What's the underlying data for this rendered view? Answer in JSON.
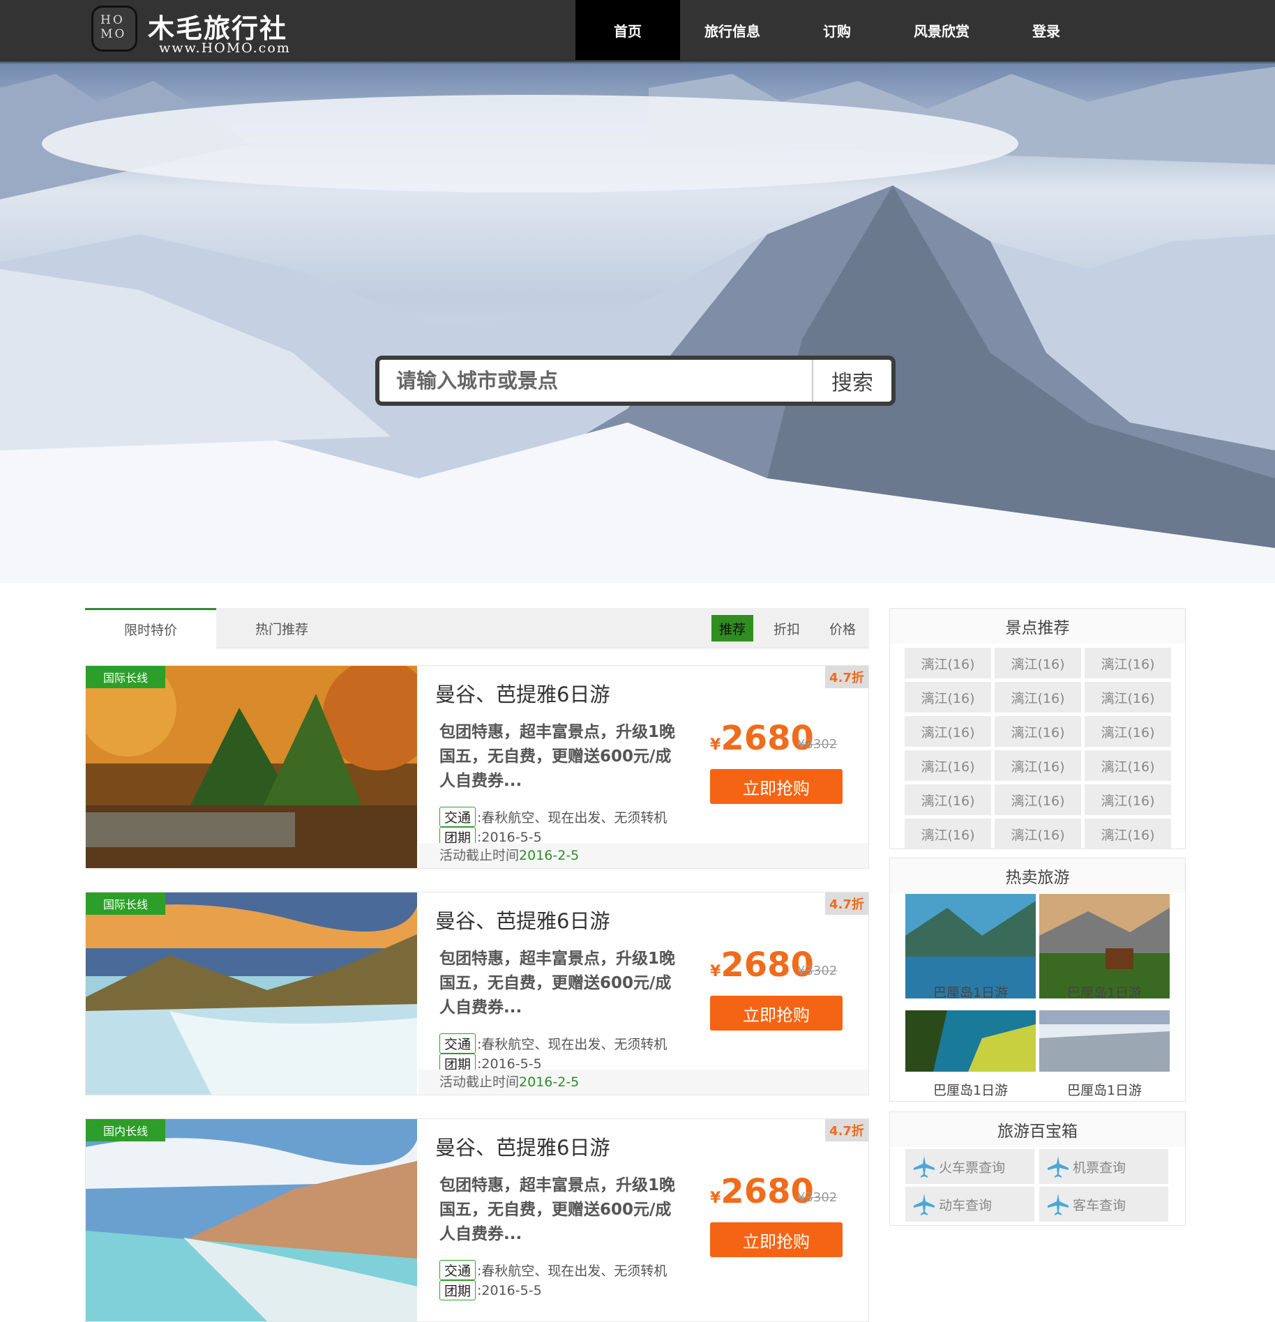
{
  "brand": {
    "badge": "HO\nMO",
    "name": "木毛旅行社",
    "url": "www.HOMO.com"
  },
  "nav": [
    "首页",
    "旅行信息",
    "订购",
    "风景欣赏",
    "登录"
  ],
  "search": {
    "placeholder": "请输入城市或景点",
    "button": "搜索"
  },
  "tabs": [
    "限时特价",
    "热门推荐"
  ],
  "sort": [
    "推荐",
    "折扣",
    "价格"
  ],
  "products": [
    {
      "tag": "国际长线",
      "discount": "4.7折",
      "title": "曼谷、芭提雅6日游",
      "desc": "包团特惠，超丰富景点，升级1晚国五，无自费，更赠送600元/成人自费券...",
      "traffic_label": "交通",
      "traffic": ":春秋航空、现在出发、无须转机",
      "group_label": "团期",
      "group": ":2016-5-5",
      "deadline_label": "活动截止时间",
      "deadline": "2016-2-5",
      "yen": "¥",
      "price": "2680",
      "old_price": "¥3302",
      "buy": "立即抢购"
    },
    {
      "tag": "国际长线",
      "discount": "4.7折",
      "title": "曼谷、芭提雅6日游",
      "desc": "包团特惠，超丰富景点，升级1晚国五，无自费，更赠送600元/成人自费券...",
      "traffic_label": "交通",
      "traffic": ":春秋航空、现在出发、无须转机",
      "group_label": "团期",
      "group": ":2016-5-5",
      "deadline_label": "活动截止时间",
      "deadline": "2016-2-5",
      "yen": "¥",
      "price": "2680",
      "old_price": "¥3302",
      "buy": "立即抢购"
    },
    {
      "tag": "国内长线",
      "discount": "4.7折",
      "title": "曼谷、芭提雅6日游",
      "desc": "包团特惠，超丰富景点，升级1晚国五，无自费，更赠送600元/成人自费券...",
      "traffic_label": "交通",
      "traffic": ":春秋航空、现在出发、无须转机",
      "group_label": "团期",
      "group": ":2016-5-5",
      "yen": "¥",
      "price": "2680",
      "old_price": "¥3302",
      "buy": "立即抢购"
    }
  ],
  "sidebar": {
    "spots_title": "景点推荐",
    "spots": [
      "漓江(16)",
      "漓江(16)",
      "漓江(16)",
      "漓江(16)",
      "漓江(16)",
      "漓江(16)",
      "漓江(16)",
      "漓江(16)",
      "漓江(16)",
      "漓江(16)",
      "漓江(16)",
      "漓江(16)",
      "漓江(16)",
      "漓江(16)",
      "漓江(16)",
      "漓江(16)",
      "漓江(16)",
      "漓江(16)"
    ],
    "hot_title": "热卖旅游",
    "hot": [
      {
        "label": "巴厘岛1日游"
      },
      {
        "label": "巴厘岛1日游"
      },
      {
        "label": "巴厘岛1日游"
      },
      {
        "label": "巴厘岛1日游"
      }
    ],
    "tools_title": "旅游百宝箱",
    "tools": [
      "火车票查询",
      "机票查询",
      "动车查询",
      "客车查询"
    ]
  },
  "colors": {
    "accent_green": "#2e9e2a",
    "accent_orange": "#f56414",
    "header": "#333333"
  }
}
